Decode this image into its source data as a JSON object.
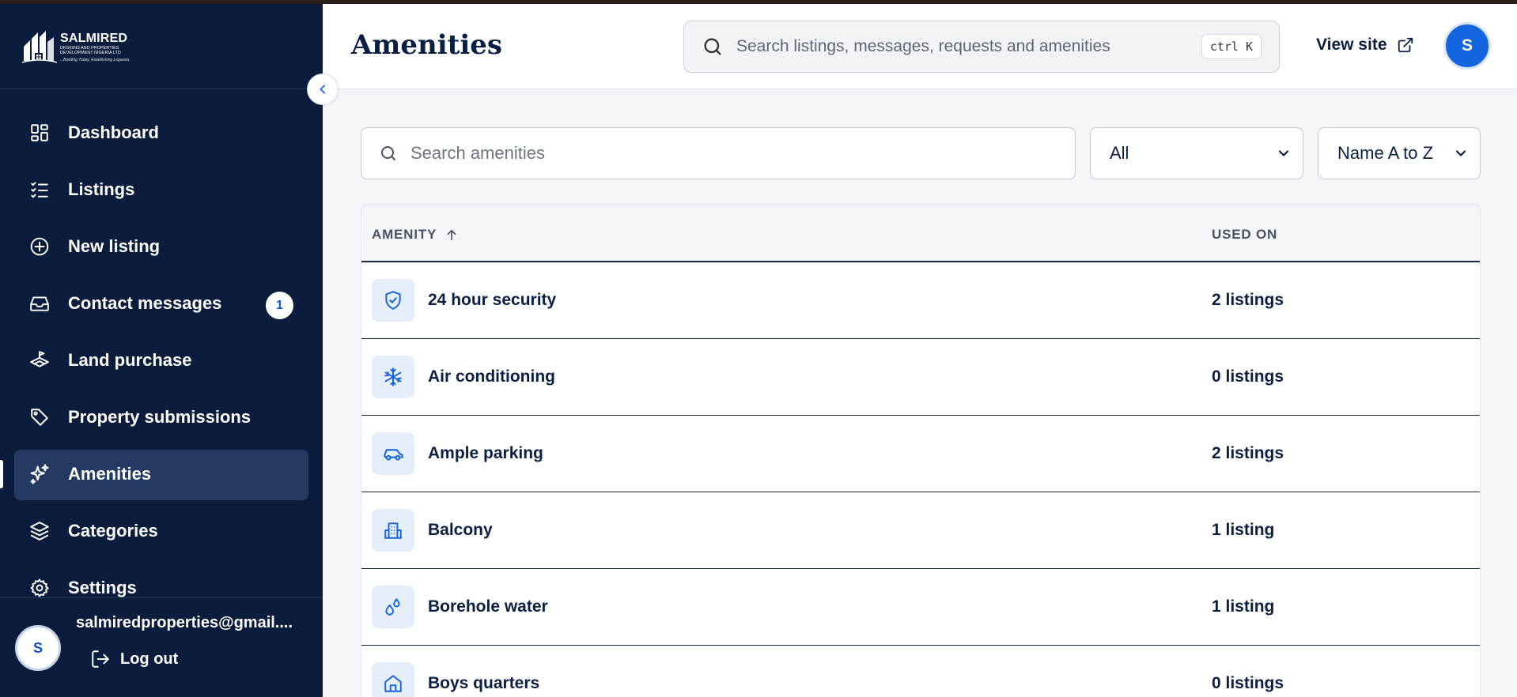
{
  "brand": {
    "name": "SALMIRED",
    "line2": "DESIGNS AND PROPERTIES",
    "line3": "DEVELOPMENT NIGERIA LTD",
    "tagline": "...Building Today, Establishing Legacies"
  },
  "header": {
    "title": "Amenities",
    "search_placeholder": "Search listings, messages, requests and amenities",
    "shortcut": "ctrl K",
    "view_site": "View site",
    "avatar_initial": "S"
  },
  "sidebar": {
    "items": [
      {
        "label": "Dashboard",
        "icon": "grid-icon"
      },
      {
        "label": "Listings",
        "icon": "checklist-icon"
      },
      {
        "label": "New listing",
        "icon": "plus-circle-icon"
      },
      {
        "label": "Contact messages",
        "icon": "inbox-icon",
        "badge": "1"
      },
      {
        "label": "Land purchase",
        "icon": "land-icon"
      },
      {
        "label": "Property submissions",
        "icon": "tag-icon"
      },
      {
        "label": "Amenities",
        "icon": "sparkles-icon",
        "active": true
      },
      {
        "label": "Categories",
        "icon": "layers-icon"
      },
      {
        "label": "Settings",
        "icon": "gear-icon"
      }
    ],
    "user": {
      "initial": "S",
      "email": "salmiredproperties@gmail....",
      "logout": "Log out"
    }
  },
  "filters": {
    "search_placeholder": "Search amenities",
    "type_selected": "All",
    "sort_selected": "Name A to Z"
  },
  "table": {
    "columns": [
      "AMENITY",
      "USED ON"
    ],
    "rows": [
      {
        "name": "24 hour security",
        "used_on": "2 listings",
        "icon": "shield-check-icon"
      },
      {
        "name": "Air conditioning",
        "used_on": "0 listings",
        "icon": "snowflake-icon"
      },
      {
        "name": "Ample parking",
        "used_on": "2 listings",
        "icon": "car-icon"
      },
      {
        "name": "Balcony",
        "used_on": "1 listing",
        "icon": "building-icon"
      },
      {
        "name": "Borehole water",
        "used_on": "1 listing",
        "icon": "water-drops-icon"
      },
      {
        "name": "Boys quarters",
        "used_on": "0 listings",
        "icon": "house-icon"
      }
    ]
  },
  "colors": {
    "sidebar_bg": "#0c1c3d",
    "sidebar_active": "#243a63",
    "accent": "#1466e0",
    "icon_tint_bg": "#e6eef9",
    "text_dark": "#0b1f44"
  }
}
